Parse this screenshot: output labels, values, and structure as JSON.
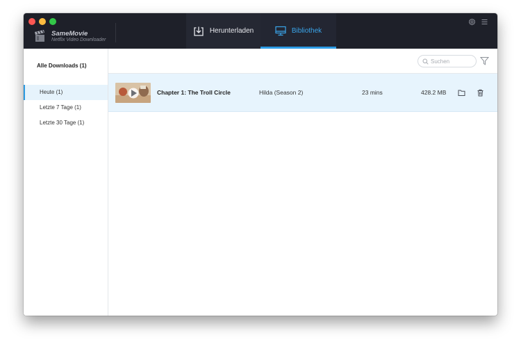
{
  "window": {
    "brand": {
      "name": "SameMovie",
      "subtitle": "Netflix Video Downloader"
    },
    "icons": {
      "logo": "film-clapper-icon",
      "settings": "gear-icon",
      "menu": "hamburger-menu-icon"
    }
  },
  "tabs": [
    {
      "label": "Herunterladen",
      "icon": "download-icon",
      "active": false
    },
    {
      "label": "Bibliothek",
      "icon": "monitor-icon",
      "active": true
    }
  ],
  "sidebar": {
    "heading": "Alle Downloads (1)",
    "items": [
      {
        "label": "Heute (1)",
        "active": true
      },
      {
        "label": "Letzte 7 Tage (1)",
        "active": false
      },
      {
        "label": "Letzte 30 Tage (1)",
        "active": false
      }
    ]
  },
  "search": {
    "placeholder": "Suchen",
    "value": ""
  },
  "downloads": [
    {
      "title": "Chapter 1: The Troll Circle",
      "series": "Hilda (Season 2)",
      "duration": "23 mins",
      "size": "428.2 MB",
      "thumbnail_icon": "play-icon"
    }
  ],
  "colors": {
    "titlebar": "#1e2029",
    "accent": "#2c9ce6",
    "selected_row": "#e7f4fd"
  }
}
